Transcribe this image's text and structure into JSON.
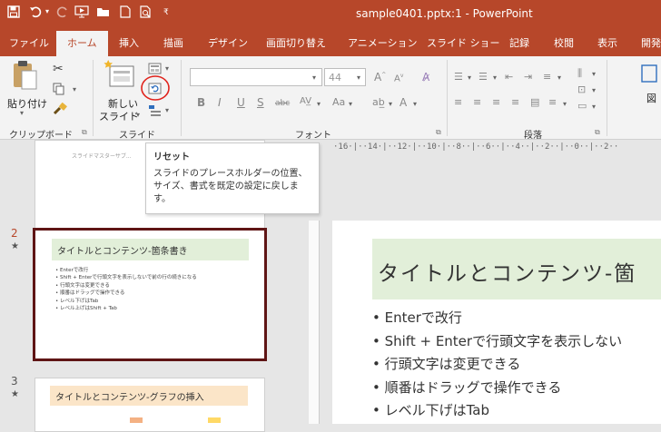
{
  "app": {
    "title": "sample0401.pptx:1  -  PowerPoint",
    "accent": "#b7472a"
  },
  "quick_access": [
    "save-icon",
    "undo-icon",
    "redo-icon",
    "from-beginning-icon",
    "open-icon",
    "new-icon",
    "print-preview-icon",
    "customize-icon"
  ],
  "tabs": [
    {
      "label": "ファイル"
    },
    {
      "label": "ホーム",
      "active": true
    },
    {
      "label": "挿入"
    },
    {
      "label": "描画"
    },
    {
      "label": "デザイン"
    },
    {
      "label": "画面切り替え"
    },
    {
      "label": "アニメーション"
    },
    {
      "label": "スライド ショー"
    },
    {
      "label": "記録"
    },
    {
      "label": "校閲"
    },
    {
      "label": "表示"
    },
    {
      "label": "開発"
    }
  ],
  "ribbon": {
    "clipboard": {
      "paste_label": "貼り付け",
      "group_label": "クリップボード"
    },
    "slides": {
      "new_slide_line1": "新しい",
      "new_slide_line2": "スライド",
      "group_label": "スライド"
    },
    "font": {
      "font_name": "",
      "font_size": "44",
      "group_label": "フォント"
    },
    "paragraph": {
      "group_label": "段落"
    },
    "drawing_partial": "図"
  },
  "tooltip": {
    "title": "リセット",
    "body": "スライドのプレースホルダーの位置、サイズ、書式を既定の設定に戻します。"
  },
  "thumbnails": [
    {
      "number": "",
      "star": "",
      "subtitle": "スライドマスターサブ..."
    },
    {
      "number": "2",
      "star": "★",
      "title": "タイトルとコンテンツ-箇条書き",
      "bullets": [
        "• Enterで改行",
        "• Shift + Enterで行頭文字を表示しないで前の行の続きになる",
        "• 行頭文字は変更できる",
        "• 順番はドラッグで操作できる",
        "• レベル下げはTab",
        "• レベル上げはShift + Tab"
      ]
    },
    {
      "number": "3",
      "star": "★",
      "title": "タイトルとコンテンツ-グラフの挿入"
    }
  ],
  "ruler": {
    "horizontal": "·16·|··14·|··12·|··10·|··8··|··6··|··4··|··2··|··0··|··2··"
  },
  "main_slide": {
    "title": "タイトルとコンテンツ-箇",
    "bullets": [
      "• Enterで改行",
      "• Shift + Enterで行頭文字を表示しない",
      "• 行頭文字は変更できる",
      "• 順番はドラッグで操作できる",
      "• レベル下げはTab"
    ],
    "title_bg": "#e2efd9"
  }
}
